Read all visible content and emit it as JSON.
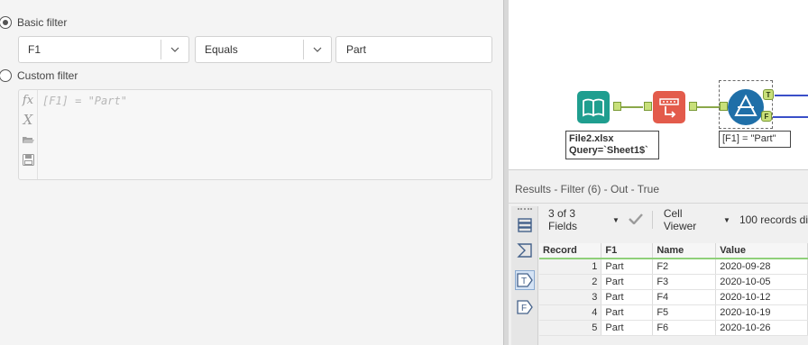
{
  "filter": {
    "basic_label": "Basic filter",
    "custom_label": "Custom filter",
    "field_value": "F1",
    "operator_value": "Equals",
    "compare_value": "Part",
    "expression_placeholder": "[F1] = \"Part\""
  },
  "canvas": {
    "input_note_line1": "File2.xlsx",
    "input_note_line2": "Query=`Sheet1$`",
    "filter_note": "[F1] = \"Part\"",
    "true_anchor": "T",
    "false_anchor": "F"
  },
  "results": {
    "title": "Results - Filter (6) - Out - True",
    "fields_label": "3 of 3 Fields",
    "viewer_label": "Cell Viewer",
    "records_label": "100 records di",
    "columns": [
      "Record",
      "F1",
      "Name",
      "Value"
    ],
    "rows": [
      [
        "1",
        "Part",
        "F2",
        "2020-09-28"
      ],
      [
        "2",
        "Part",
        "F3",
        "2020-10-05"
      ],
      [
        "3",
        "Part",
        "F4",
        "2020-10-12"
      ],
      [
        "4",
        "Part",
        "F5",
        "2020-10-19"
      ],
      [
        "5",
        "Part",
        "F6",
        "2020-10-26"
      ]
    ],
    "side_tabs": {
      "true_tab": "T",
      "false_tab": "F"
    }
  },
  "colors": {
    "input_tool": "#1f9e8f",
    "select_tool": "#e35b4b",
    "filter_tool": "#1f6fa8",
    "anchor_green": "#c8e07a",
    "header_underline": "#8fd07a"
  },
  "icons": {
    "fx": "fx-icon",
    "variable": "variable-x-icon",
    "open": "folder-open-icon",
    "save": "save-disk-icon",
    "chevron": "chevron-down-icon",
    "check": "check-icon"
  }
}
